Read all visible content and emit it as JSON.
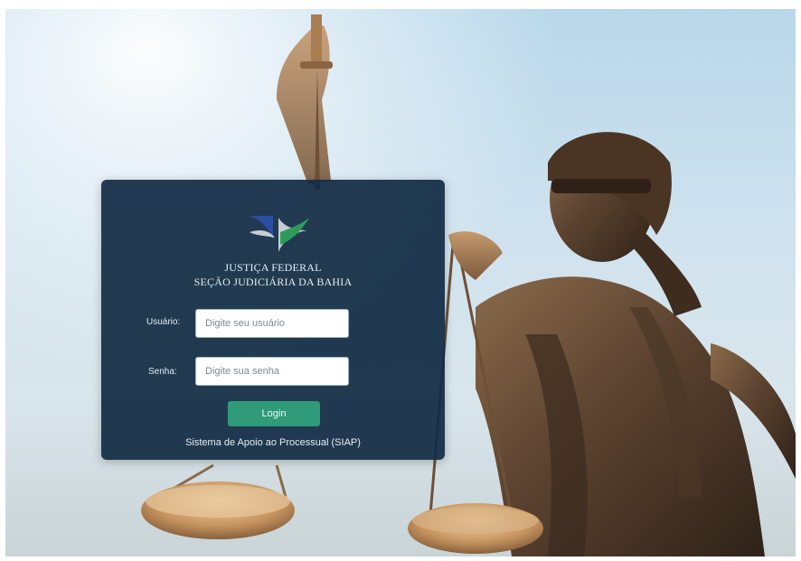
{
  "organization": {
    "line1": "JUSTIÇA FEDERAL",
    "line2": "SEÇÃO JUDICIÁRIA DA BAHIA"
  },
  "form": {
    "username_label": "Usuário:",
    "username_placeholder": "Digite seu usuário",
    "username_value": "",
    "password_label": "Senha:",
    "password_placeholder": "Digite sua senha",
    "password_value": "",
    "login_label": "Login"
  },
  "footer": {
    "system_name": "Sistema de Apoio ao Processual (SIAP)"
  },
  "icons": {
    "logo": "justica-federal-logo-icon",
    "background": "lady-justice-statue"
  },
  "colors": {
    "panel_bg": "#122c44",
    "login_button": "#2f9b78",
    "logo_blue": "#2b4fa3",
    "logo_green": "#2e9a5a",
    "logo_gray": "#c9cdd2"
  }
}
